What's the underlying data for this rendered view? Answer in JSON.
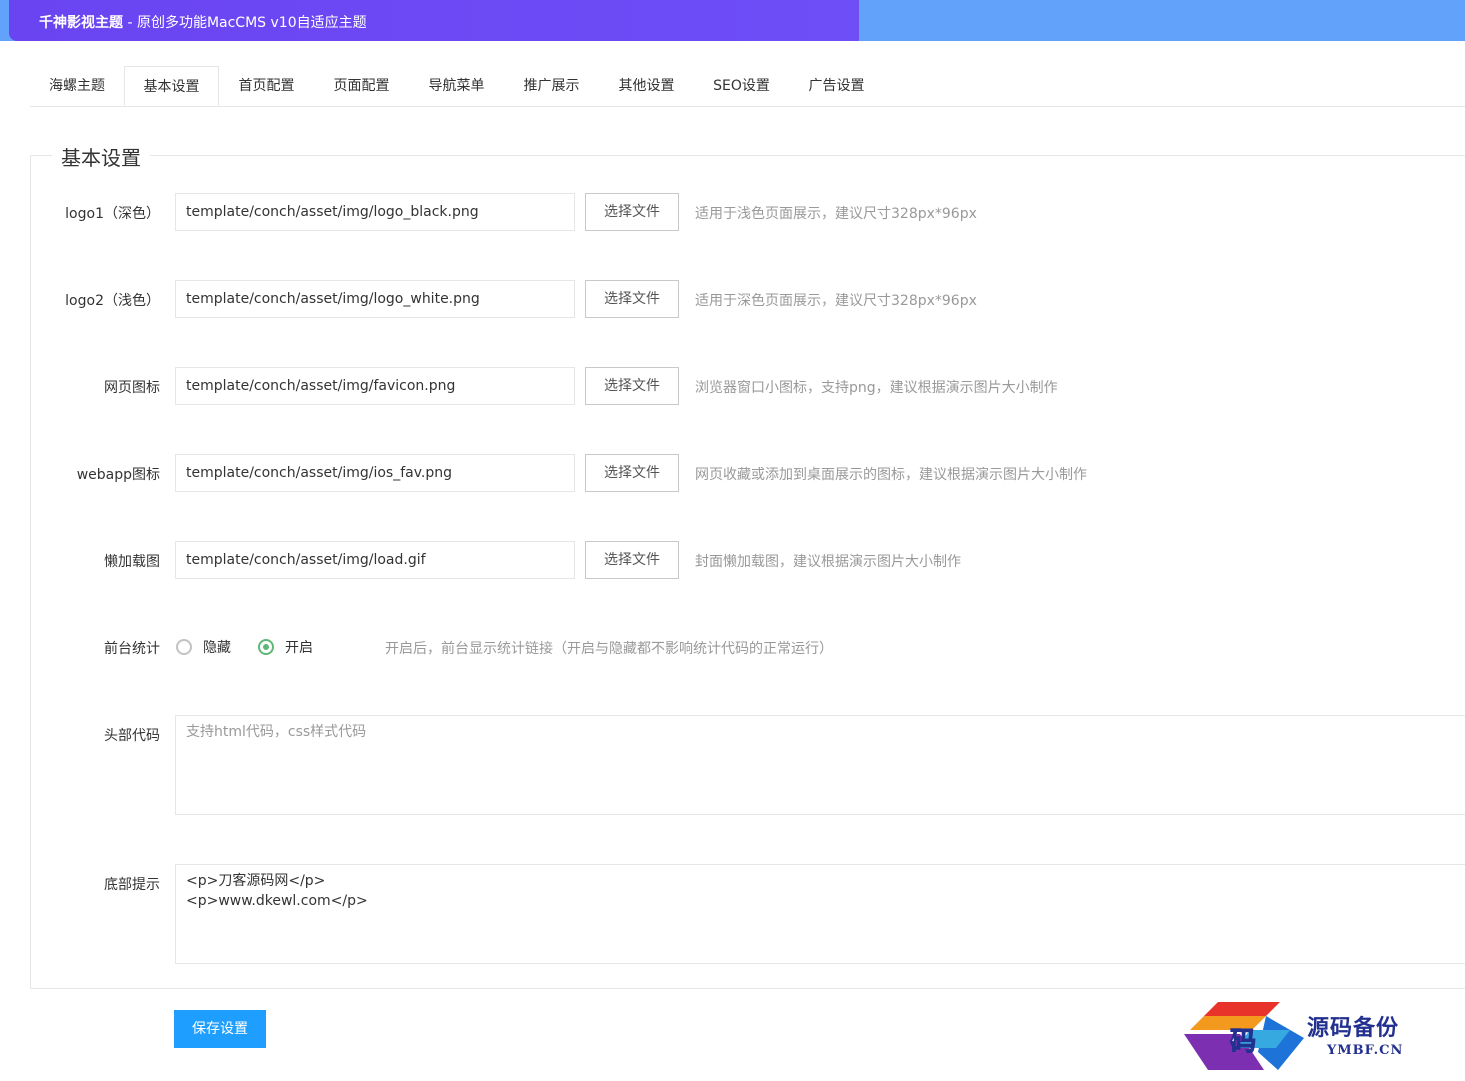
{
  "header": {
    "title_bold": "千神影视主题",
    "title_rest": " - 原创多功能MacCMS v10自适应主题"
  },
  "tabs": [
    {
      "label": "海螺主题"
    },
    {
      "label": "基本设置",
      "active": true
    },
    {
      "label": "首页配置"
    },
    {
      "label": "页面配置"
    },
    {
      "label": "导航菜单"
    },
    {
      "label": "推广展示"
    },
    {
      "label": "其他设置"
    },
    {
      "label": "SEO设置"
    },
    {
      "label": "广告设置"
    }
  ],
  "section": {
    "legend": "基本设置"
  },
  "file_button_label": "选择文件",
  "fields": {
    "logo1": {
      "label": "logo1（深色）",
      "value": "template/conch/asset/img/logo_black.png",
      "hint": "适用于浅色页面展示，建议尺寸328px*96px"
    },
    "logo2": {
      "label": "logo2（浅色）",
      "value": "template/conch/asset/img/logo_white.png",
      "hint": "适用于深色页面展示，建议尺寸328px*96px"
    },
    "favicon": {
      "label": "网页图标",
      "value": "template/conch/asset/img/favicon.png",
      "hint": "浏览器窗口小图标，支持png，建议根据演示图片大小制作"
    },
    "webapp": {
      "label": "webapp图标",
      "value": "template/conch/asset/img/ios_fav.png",
      "hint": "网页收藏或添加到桌面展示的图标，建议根据演示图片大小制作"
    },
    "lazyload": {
      "label": "懒加载图",
      "value": "template/conch/asset/img/load.gif",
      "hint": "封面懒加载图，建议根据演示图片大小制作"
    },
    "stats": {
      "label": "前台统计",
      "option_hide": "隐藏",
      "option_on": "开启",
      "selected": "开启",
      "hint": "开启后，前台显示统计链接（开启与隐藏都不影响统计代码的正常运行）"
    },
    "head_code": {
      "label": "头部代码",
      "placeholder": "支持html代码，css样式代码",
      "value": ""
    },
    "footer": {
      "label": "底部提示",
      "lines": [
        "<p>刀客源码网</p>",
        "<p>www.dkewl.com</p>"
      ]
    }
  },
  "save_button": "保存设置",
  "watermark": {
    "main": "源码备份",
    "sub": "YMBF.CN",
    "logo_char": "码"
  },
  "colors": {
    "header_left": "#6a44f1",
    "header_right": "#62a2fb",
    "primary_button": "#1e9fff",
    "radio_checked": "#5fb878"
  }
}
